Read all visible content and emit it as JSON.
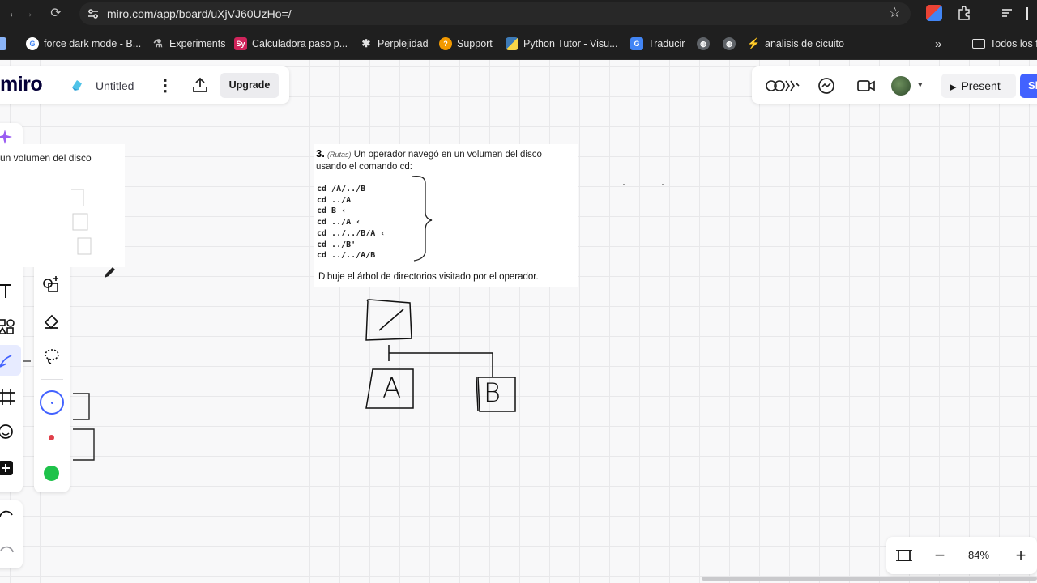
{
  "browser": {
    "url": "miro.com/app/board/uXjVJ60UzHo=/",
    "bookmarks": [
      {
        "label": "force dark mode - B...",
        "icon": "google-icon",
        "color": "#ffffff"
      },
      {
        "label": "Experiments",
        "icon": "flask-icon",
        "color": "#9aa0a6"
      },
      {
        "label": "Calculadora paso p...",
        "icon": "symbolab-icon",
        "color": "#d0245b",
        "badge": "Sy"
      },
      {
        "label": "Perplejidad",
        "icon": "perplexity-icon",
        "color": "#e3e3e3"
      },
      {
        "label": "Support",
        "icon": "support-icon",
        "color": "#f29900"
      },
      {
        "label": "Python Tutor - Visu...",
        "icon": "python-icon",
        "color": "#3d7ab6"
      },
      {
        "label": "Traducir",
        "icon": "translate-icon",
        "color": "#4285f4"
      },
      {
        "label": "",
        "icon": "globe-icon",
        "color": "#9aa0a6"
      },
      {
        "label": "",
        "icon": "globe-icon",
        "color": "#9aa0a6"
      },
      {
        "label": "analisis de cicuito",
        "icon": "circuit-icon",
        "color": "#c2185b"
      }
    ],
    "more": "»",
    "all_bookmarks": "Todos los f"
  },
  "miro": {
    "logo": "miro",
    "board_title": "Untitled",
    "upgrade": "Upgrade",
    "present": "Present",
    "share_partial": "Sh",
    "zoom": "84%",
    "accent": "#4262ff"
  },
  "board": {
    "left_fragment_title": "un volumen del disco",
    "exercise": {
      "number": "3.",
      "tag": "(Rutas)",
      "line1": "Un operador navegó en un volumen del disco",
      "line2": "usando el comando cd:",
      "commands": [
        "cd /A/../B",
        "cd ../A",
        "cd B ‹",
        "cd ../A ‹",
        "cd ../../B/A ‹",
        "cd ../B'",
        "cd ../../A/B"
      ],
      "footer": "Dibuje el árbol de directorios visitado por el operador."
    },
    "tree_nodes": [
      "A",
      "B"
    ]
  }
}
